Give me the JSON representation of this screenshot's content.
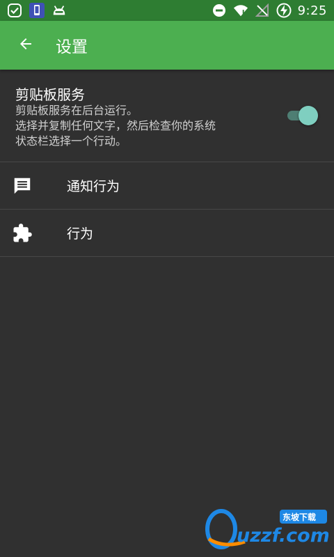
{
  "status_bar": {
    "time": "9:25",
    "left_icons": [
      "check-circle-icon",
      "phone-app-icon",
      "android-icon"
    ],
    "right_icons": [
      "do-not-disturb-icon",
      "wifi-icon",
      "no-signal-icon",
      "battery-charging-icon"
    ]
  },
  "app_bar": {
    "title": "设置",
    "back_icon": "arrow-back-icon",
    "color": "#4CAF50",
    "status_color": "#2E7D32"
  },
  "clipboard_service": {
    "title": "剪贴板服务",
    "description_lines": [
      "剪贴板服务在后台运行。",
      "选择并复制任何文字，然后检查你的系统",
      "状态栏选择一个行动。"
    ],
    "enabled": true,
    "toggle_color": "#7FCFC0"
  },
  "menu": [
    {
      "icon": "message-icon",
      "label": "通知行为"
    },
    {
      "icon": "puzzle-icon",
      "label": "行为"
    }
  ],
  "watermark": {
    "brand": "uzzf.com",
    "tag": "东坡下载"
  }
}
